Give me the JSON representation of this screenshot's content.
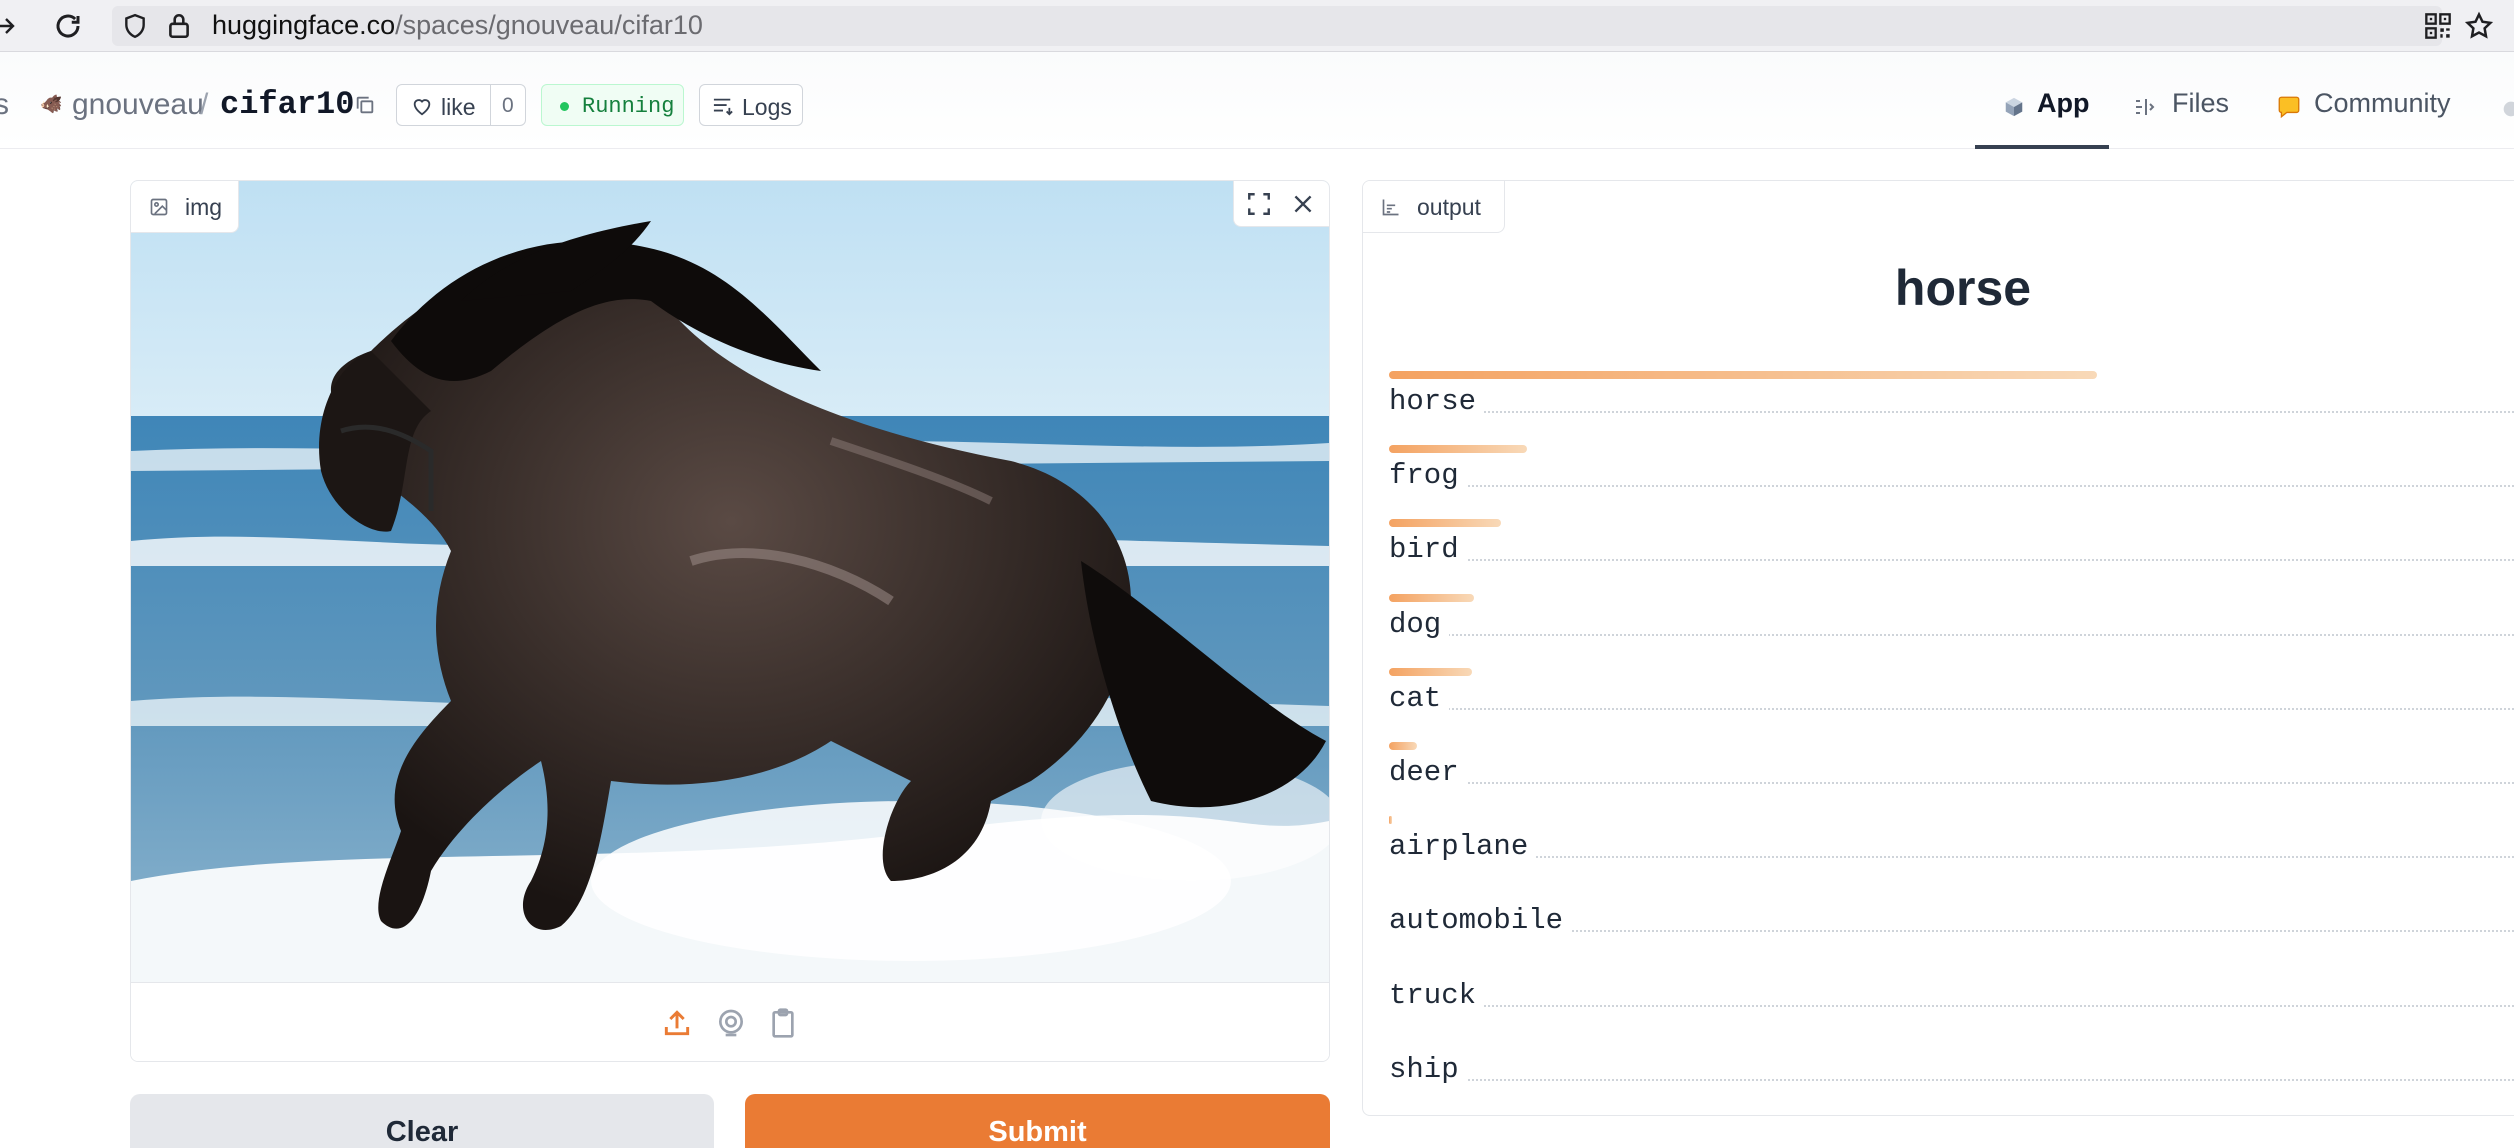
{
  "browser": {
    "url_host": "huggingface.co",
    "url_path": "/spaces/gnouveau/cifar10"
  },
  "space": {
    "owner": "gnouveau",
    "separator": "/",
    "name": "cifar10",
    "like_label": "like",
    "like_count": "0",
    "status": "Running",
    "logs_label": "Logs",
    "tabs": [
      {
        "label": "App",
        "icon": "cube-icon",
        "active": true
      },
      {
        "label": "Files",
        "icon": "files-icon",
        "active": false
      },
      {
        "label": "Community",
        "icon": "community-icon",
        "active": false
      }
    ]
  },
  "input": {
    "label": "img",
    "image_subject": "black horse galloping through ocean surf",
    "source_icons": [
      "upload-icon",
      "webcam-icon",
      "clipboard-icon"
    ]
  },
  "buttons": {
    "clear": "Clear",
    "submit": "Submit"
  },
  "output": {
    "label": "output",
    "predicted": "horse",
    "confidences": [
      {
        "label": "horse",
        "value_text": "61",
        "fraction": 0.615
      },
      {
        "label": "frog",
        "value_text": "12",
        "fraction": 0.12
      },
      {
        "label": "bird",
        "value_text": "10",
        "fraction": 0.097
      },
      {
        "label": "dog",
        "value_text": "7",
        "fraction": 0.074
      },
      {
        "label": "cat",
        "value_text": "7",
        "fraction": 0.072
      },
      {
        "label": "deer",
        "value_text": "2",
        "fraction": 0.024
      },
      {
        "label": "airplane",
        "value_text": "0",
        "fraction": 0.002
      },
      {
        "label": "automobile",
        "value_text": "0",
        "fraction": 0.0
      },
      {
        "label": "truck",
        "value_text": "0",
        "fraction": 0.0
      },
      {
        "label": "ship",
        "value_text": "0",
        "fraction": 0.0
      }
    ]
  },
  "colors": {
    "accent": "#ea7b34",
    "bar_start": "#f4a261",
    "bar_end": "#f8d9b8",
    "running": "#22c55e"
  }
}
